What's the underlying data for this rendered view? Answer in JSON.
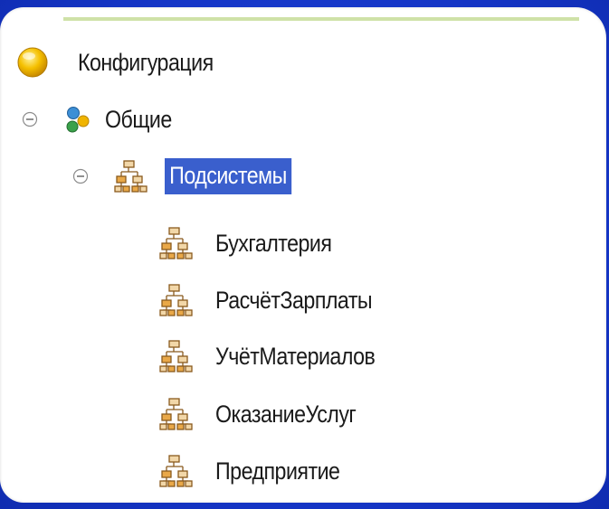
{
  "tree": {
    "root": {
      "label": "Конфигурация",
      "icon": "configuration-icon",
      "color": "#f0b400"
    },
    "common": {
      "label": "Общие",
      "icon": "common-objects-icon",
      "expanded": true
    },
    "subsystems": {
      "label": "Подсистемы",
      "icon": "subsystem-icon",
      "expanded": true,
      "selected": true,
      "highlight": "#3a5fcd"
    },
    "children": [
      {
        "label": "Бухгалтерия",
        "icon": "subsystem-icon"
      },
      {
        "label": "РасчётЗарплаты",
        "icon": "subsystem-icon"
      },
      {
        "label": "УчётМатериалов",
        "icon": "subsystem-icon"
      },
      {
        "label": "ОказаниеУслуг",
        "icon": "subsystem-icon"
      },
      {
        "label": "Предприятие",
        "icon": "subsystem-icon"
      }
    ]
  }
}
